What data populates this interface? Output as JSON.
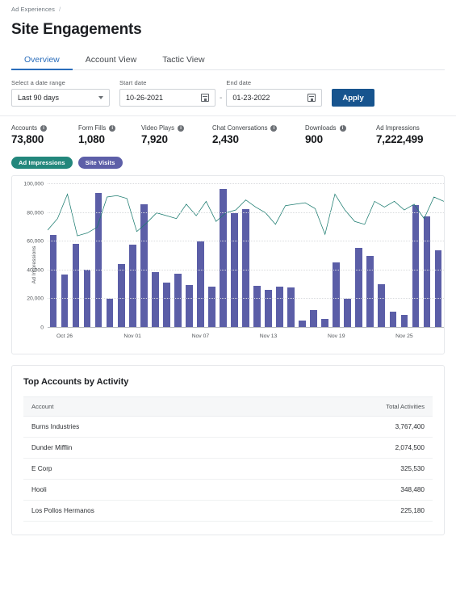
{
  "breadcrumb": {
    "root": "Ad Experiences",
    "separator": "/"
  },
  "header": {
    "title": "Site Engagements"
  },
  "tabs": [
    {
      "label": "Overview",
      "active": true
    },
    {
      "label": "Account View",
      "active": false
    },
    {
      "label": "Tactic View",
      "active": false
    }
  ],
  "filters": {
    "range_label": "Select a date range",
    "range_value": "Last 90 days",
    "start_label": "Start date",
    "start_value": "10-26-2021",
    "separator": "-",
    "end_label": "End date",
    "end_value": "01-23-2022",
    "apply_label": "Apply"
  },
  "kpis": [
    {
      "label": "Accounts",
      "value": "73,800",
      "info": true
    },
    {
      "label": "Form Fills",
      "value": "1,080",
      "info": true
    },
    {
      "label": "Video Plays",
      "value": "7,920",
      "info": true
    },
    {
      "label": "Chat Conversations",
      "value": "2,430",
      "info": true
    },
    {
      "label": "Downloads",
      "value": "900",
      "info": true
    },
    {
      "label": "Ad Impressions",
      "value": "7,222,499",
      "info": false
    }
  ],
  "legend": [
    {
      "label": "Ad Impressions",
      "color": "#23877c"
    },
    {
      "label": "Site Visits",
      "color": "#5d5fa8"
    }
  ],
  "chart_data": {
    "type": "bar",
    "title": "",
    "xlabel": "",
    "ylabel": "Ad Impressions",
    "ylim": [
      0,
      100000
    ],
    "yticks": [
      0,
      20000,
      40000,
      60000,
      80000,
      100000
    ],
    "ytick_labels": [
      "0",
      "20,000",
      "40,000",
      "60,000",
      "80,000",
      "100,000"
    ],
    "grid": true,
    "legend_position": "above-chart",
    "xtick_labels": [
      "Oct 26",
      "Nov 01",
      "Nov 07",
      "Nov 13",
      "Nov 19",
      "Nov 25"
    ],
    "xtick_indices": [
      1,
      7,
      13,
      19,
      25,
      31
    ],
    "x": [
      "Oct 25",
      "Oct 26",
      "Oct 27",
      "Oct 28",
      "Oct 29",
      "Oct 30",
      "Oct 31",
      "Nov 01",
      "Nov 02",
      "Nov 03",
      "Nov 04",
      "Nov 05",
      "Nov 06",
      "Nov 07",
      "Nov 08",
      "Nov 09",
      "Nov 10",
      "Nov 11",
      "Nov 12",
      "Nov 13",
      "Nov 14",
      "Nov 15",
      "Nov 16",
      "Nov 17",
      "Nov 18",
      "Nov 19",
      "Nov 20",
      "Nov 21",
      "Nov 22",
      "Nov 23",
      "Nov 24",
      "Nov 25",
      "Nov 26",
      "Nov 27",
      "Nov 28"
    ],
    "series": [
      {
        "name": "Site Visits",
        "type": "bar",
        "color": "#5b5ea7",
        "values": [
          64500,
          37200,
          58600,
          40200,
          93600,
          20200,
          44500,
          57800,
          85800,
          38600,
          31200,
          37800,
          29800,
          60200,
          28600,
          96600,
          79600,
          82400,
          29000,
          26400,
          28800,
          28200,
          5200,
          12600,
          6000,
          45400,
          20500,
          55600,
          50200,
          30600,
          11000,
          9200,
          85200,
          77400,
          54000
        ]
      },
      {
        "name": "Ad Impressions",
        "type": "line",
        "color": "#1b7b6f",
        "values": [
          68000,
          76000,
          93000,
          64000,
          66000,
          70000,
          91000,
          92000,
          90000,
          67000,
          73000,
          80000,
          78000,
          76000,
          86000,
          78000,
          88000,
          74000,
          80000,
          82000,
          89000,
          84000,
          80000,
          72000,
          85000,
          86000,
          87000,
          83000,
          65000,
          93000,
          82000,
          74000,
          72000,
          88000,
          84000,
          88000,
          82000,
          86000,
          76000,
          91000,
          88000
        ]
      }
    ]
  },
  "top_accounts": {
    "title": "Top Accounts by Activity",
    "columns": [
      "Account",
      "Total Activities"
    ],
    "rows": [
      {
        "account": "Burns Industries",
        "total": "3,767,400"
      },
      {
        "account": "Dunder Mifflin",
        "total": "2,074,500"
      },
      {
        "account": "E Corp",
        "total": "325,530"
      },
      {
        "account": "Hooli",
        "total": "348,480"
      },
      {
        "account": "Los Pollos Hermanos",
        "total": "225,180"
      }
    ]
  }
}
